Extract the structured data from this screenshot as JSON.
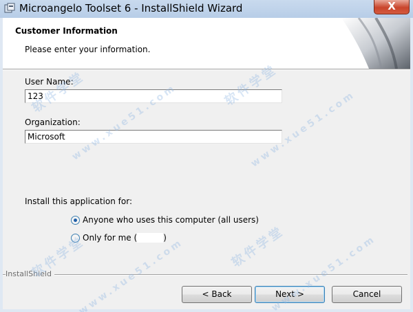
{
  "window": {
    "title": "Microangelo Toolset 6 - InstallShield Wizard",
    "close_label": "X"
  },
  "header": {
    "title": "Customer Information",
    "subtitle": "Please enter your information."
  },
  "form": {
    "user_name_label": "User Name:",
    "user_name_value": "123",
    "organization_label": "Organization:",
    "organization_value": "Microsoft",
    "install_for_label": "Install this application for:",
    "options": [
      {
        "label": "Anyone who uses this computer (all users)",
        "checked": true
      },
      {
        "label_prefix": "Only for me (",
        "label_suffix": ")",
        "checked": false
      }
    ]
  },
  "footer": {
    "brand": "InstallShield",
    "back_label": "< Back",
    "next_label": "Next >",
    "cancel_label": "Cancel"
  },
  "watermarks": {
    "text": "软件学堂",
    "site": "www.xue51.com"
  },
  "colors": {
    "titlebar": "#b7cde7",
    "close_button": "#c9452c",
    "radio_accent": "#1f5ea8"
  }
}
